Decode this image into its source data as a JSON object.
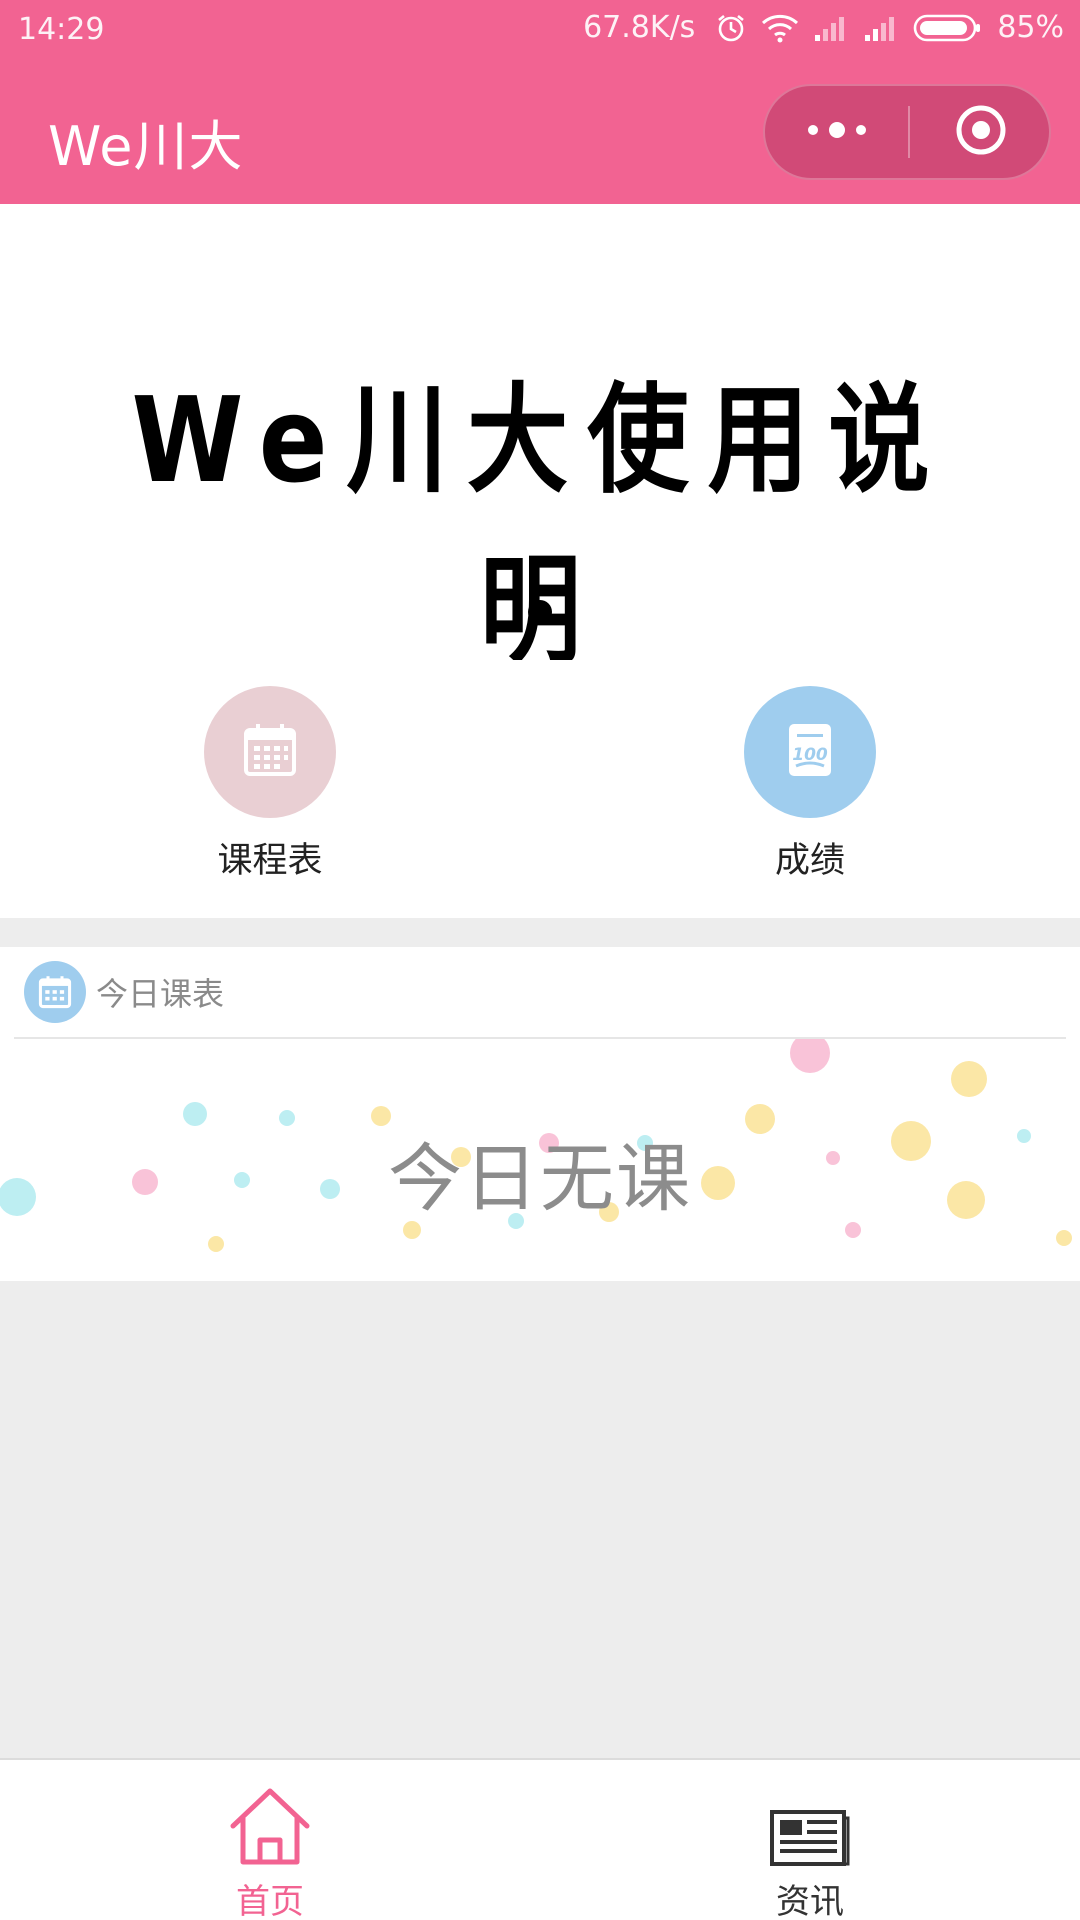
{
  "status_bar": {
    "time": "14:29",
    "net_speed": "67.8K/s",
    "battery": "85%",
    "icons": [
      "alarm-icon",
      "wifi-icon",
      "signal-icon",
      "signal-icon",
      "battery-icon"
    ]
  },
  "nav": {
    "title": "We川大",
    "capsule_icons": [
      "more-icon",
      "close-target-icon"
    ],
    "bg_color": "#f26392"
  },
  "banner": {
    "text": "We川大使用说明",
    "indicator_count": 1,
    "active_index": 0
  },
  "entries": [
    {
      "label": "课程表",
      "icon": "calendar-icon",
      "color": "#e9cfd3"
    },
    {
      "label": "成绩",
      "icon": "score-100-icon",
      "color": "#9fcdee"
    }
  ],
  "today": {
    "title": "今日课表",
    "icon": "calendar-icon",
    "empty_text": "今日无课"
  },
  "tabbar": {
    "tabs": [
      {
        "label": "首页",
        "icon": "home-icon",
        "active": true
      },
      {
        "label": "资讯",
        "icon": "news-icon",
        "active": false
      }
    ],
    "active_color": "#f26392",
    "inactive_color": "#333333"
  }
}
